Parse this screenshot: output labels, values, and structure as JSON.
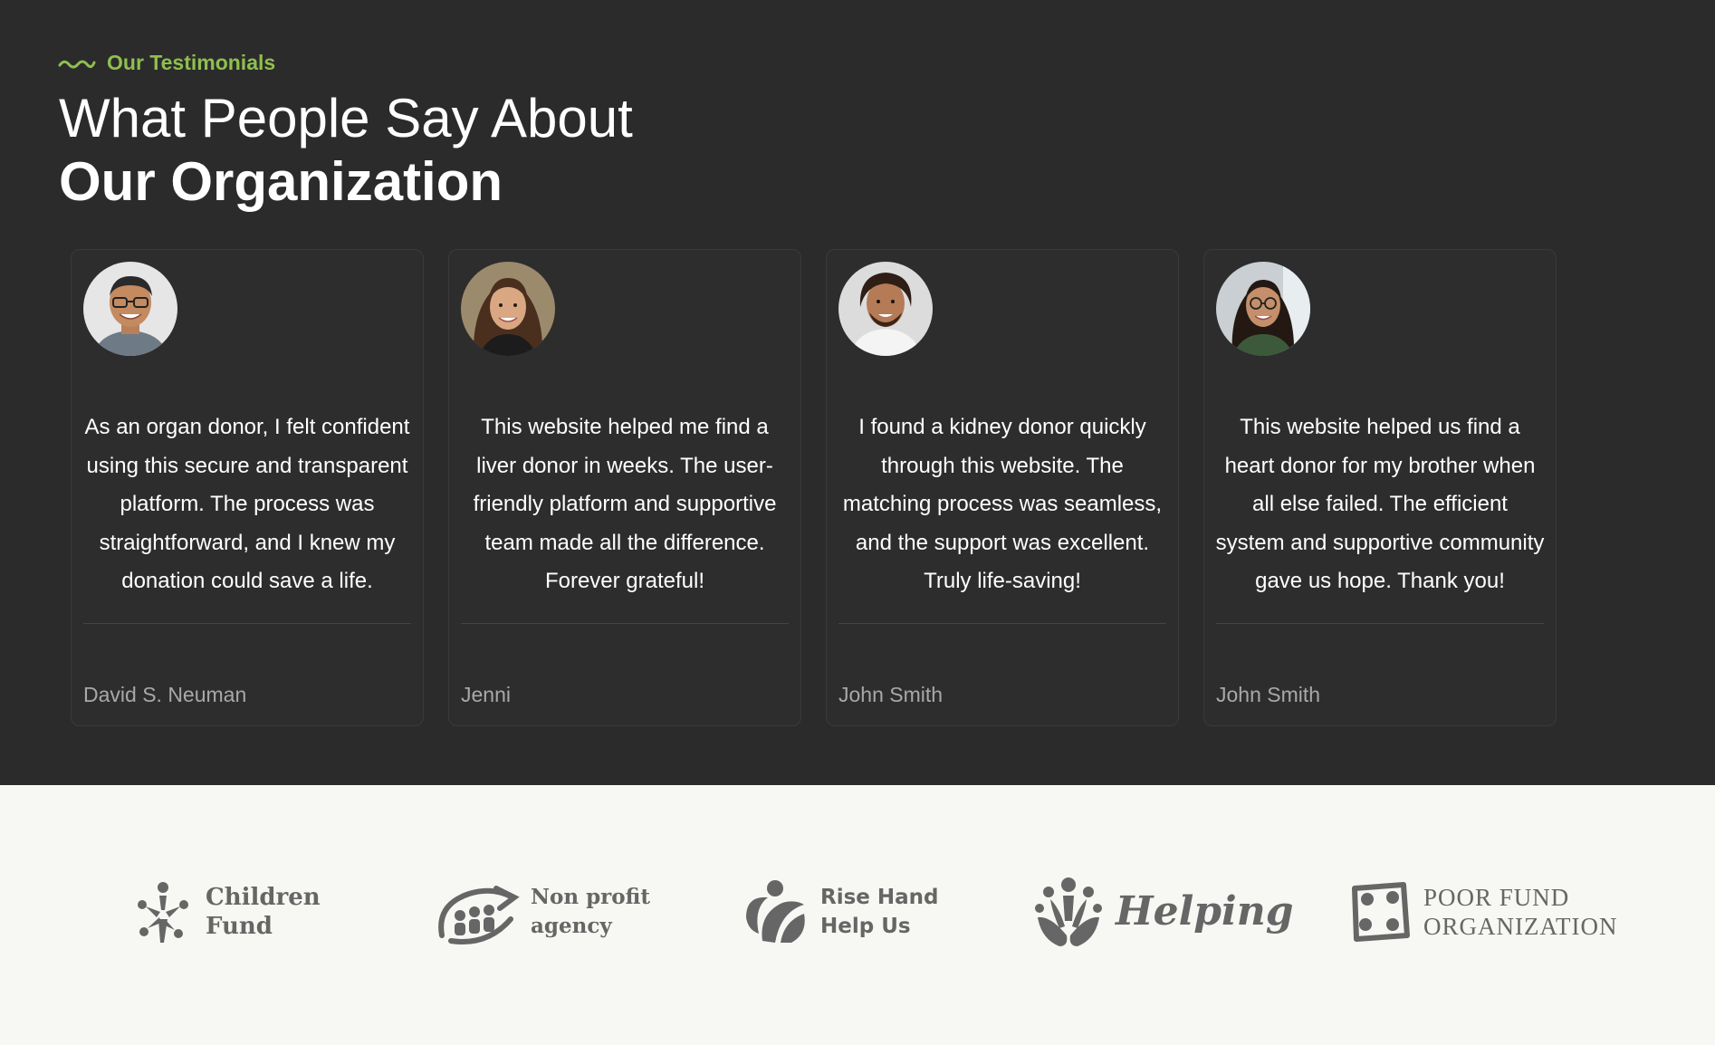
{
  "section": {
    "eyebrow": "Our Testimonials",
    "heading_line1": "What People Say About",
    "heading_line2": "Our Organization"
  },
  "testimonials": [
    {
      "quote": "As an organ donor, I felt confident using this secure and transparent platform. The process was straightforward, and I knew my donation could save a life.",
      "author": "David S. Neuman",
      "avatar": "avatar-man-glasses"
    },
    {
      "quote": "This website helped me find a liver donor in weeks. The user-friendly platform and supportive team made all the difference. Forever grateful!",
      "author": "Jenni",
      "avatar": "avatar-woman-curly-hair"
    },
    {
      "quote": "I found a kidney donor quickly through this website. The matching process was seamless, and the support was excellent. Truly life-saving!",
      "author": "John Smith",
      "avatar": "avatar-man-beard"
    },
    {
      "quote": "This website helped us find a heart donor for my brother when all else failed. The efficient system and supportive community gave us hope. Thank you!",
      "author": "John Smith",
      "avatar": "avatar-woman-glasses"
    }
  ],
  "partners": [
    {
      "line1": "Children",
      "line2": "Fund",
      "icon": "children-fund-icon"
    },
    {
      "line1": "Non profit",
      "line2": "agency",
      "icon": "non-profit-agency-icon"
    },
    {
      "line1": "Rise Hand",
      "line2": "Help Us",
      "icon": "rise-hand-icon"
    },
    {
      "line1": "Helping",
      "icon": "helping-icon"
    },
    {
      "line1": "POOR FUND",
      "line2": "ORGANIZATION",
      "icon": "poor-fund-icon"
    }
  ],
  "colors": {
    "accent": "#8fbf4f",
    "dark_bg": "#2b2b2b",
    "card_bg": "#2d2d2d",
    "light_bg": "#f7f8f3",
    "logo_gray": "#666666"
  }
}
